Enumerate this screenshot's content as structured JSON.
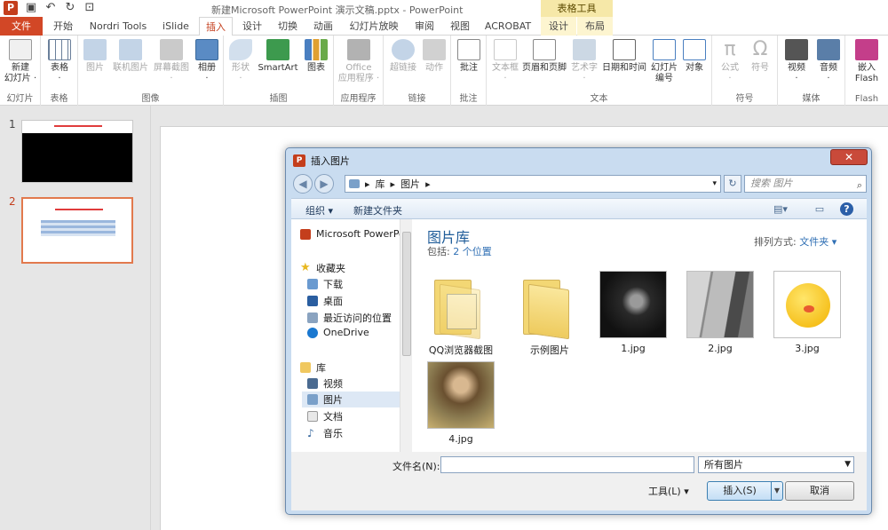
{
  "window": {
    "title": "新建Microsoft PowerPoint 演示文稿.pptx - PowerPoint",
    "context_tools": "表格工具"
  },
  "tabs": [
    {
      "label": "文件"
    },
    {
      "label": "开始"
    },
    {
      "label": "Nordri Tools"
    },
    {
      "label": "iSlide"
    },
    {
      "label": "插入"
    },
    {
      "label": "设计"
    },
    {
      "label": "切换"
    },
    {
      "label": "动画"
    },
    {
      "label": "幻灯片放映"
    },
    {
      "label": "审阅"
    },
    {
      "label": "视图"
    },
    {
      "label": "ACROBAT"
    },
    {
      "label": "设计"
    },
    {
      "label": "布局"
    }
  ],
  "ribbon": {
    "groups": [
      {
        "label": "幻灯片"
      },
      {
        "label": "表格"
      },
      {
        "label": "图像"
      },
      {
        "label": "插图"
      },
      {
        "label": "应用程序"
      },
      {
        "label": "链接"
      },
      {
        "label": "批注"
      },
      {
        "label": "文本"
      },
      {
        "label": "符号"
      },
      {
        "label": "媒体"
      },
      {
        "label": "Flash"
      }
    ],
    "buttons": {
      "new_slide": "新建\n幻灯片 ·",
      "table": "表格\n·",
      "picture": "图片",
      "online_picture": "联机图片",
      "screenshot": "屏幕截图\n·",
      "album": "相册\n·",
      "shapes": "形状\n·",
      "smartart": "SmartArt",
      "chart": "图表",
      "office_apps": "Office\n应用程序 ·",
      "hyperlink": "超链接",
      "action": "动作",
      "comment": "批注",
      "textbox": "文本框\n·",
      "header_footer": "页眉和页脚",
      "wordart": "艺术字\n·",
      "datetime": "日期和时间",
      "slide_number": "幻灯片\n编号",
      "object": "对象",
      "equation": "公式\n·",
      "symbol": "符号",
      "video": "视频\n·",
      "audio": "音频\n·",
      "flash": "嵌入\nFlash"
    }
  },
  "slides": {
    "nums": [
      "1",
      "2"
    ]
  },
  "dialog": {
    "title": "插入图片",
    "breadcrumb": [
      "库",
      "图片"
    ],
    "search_placeholder": "搜索 图片",
    "toolbar": {
      "organize": "组织 ▾",
      "new_folder": "新建文件夹"
    },
    "nav": [
      {
        "label": "Microsoft PowerPoint"
      },
      {
        "label": "收藏夹"
      },
      {
        "label": "下载"
      },
      {
        "label": "桌面"
      },
      {
        "label": "最近访问的位置"
      },
      {
        "label": "OneDrive"
      },
      {
        "label": "库"
      },
      {
        "label": "视频"
      },
      {
        "label": "图片"
      },
      {
        "label": "文档"
      },
      {
        "label": "音乐"
      }
    ],
    "library": {
      "title": "图片库",
      "includes_label": "包括:",
      "includes_value": "2 个位置",
      "sort_label": "排列方式:",
      "sort_value": "文件夹 ▾"
    },
    "files": [
      {
        "name": "QQ浏览器截图"
      },
      {
        "name": "示例图片"
      },
      {
        "name": "1.jpg"
      },
      {
        "name": "2.jpg"
      },
      {
        "name": "3.jpg"
      },
      {
        "name": "4.jpg"
      }
    ],
    "filename_label": "文件名(N):",
    "filetype_value": "所有图片",
    "tools_label": "工具(L) ▾",
    "insert_label": "插入(S)",
    "cancel_label": "取消"
  },
  "colors": {
    "accent": "#c43e1c",
    "file_tab": "#d24726",
    "link": "#2f6fb4"
  }
}
